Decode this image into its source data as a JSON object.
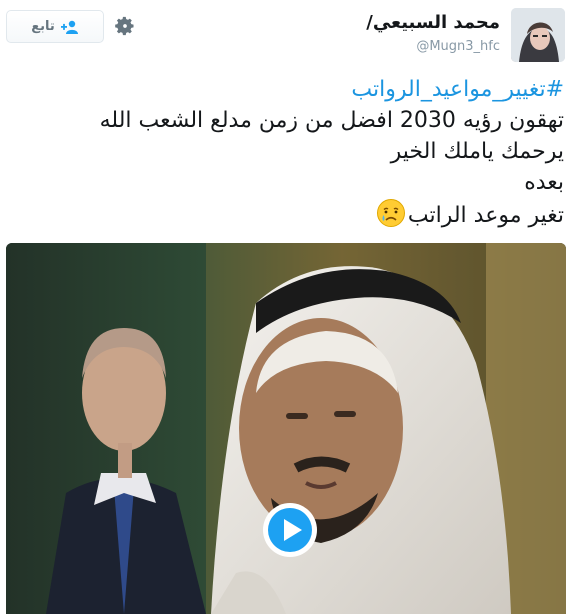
{
  "profile": {
    "name": "محمد السبيعي/",
    "handle": "@Mugn3_hfc"
  },
  "follow_button": {
    "label": "تابع",
    "icon": "add-user-icon"
  },
  "settings": {
    "icon": "gear-icon"
  },
  "tweet": {
    "hashtag": "#تغيير_مواعيد_الرواتب",
    "lines": [
      "تهقون رؤيه 2030 افضل من زمن مدلع الشعب الله",
      "يرحمك ياملك الخير",
      "بعده",
      "تغير موعد الراتب"
    ],
    "emoji": "crying-face-emoji"
  },
  "video": {
    "play_icon": "play-icon"
  },
  "colors": {
    "link": "#1b95e0",
    "handle": "#8899a6",
    "border": "#e1e8ed"
  }
}
